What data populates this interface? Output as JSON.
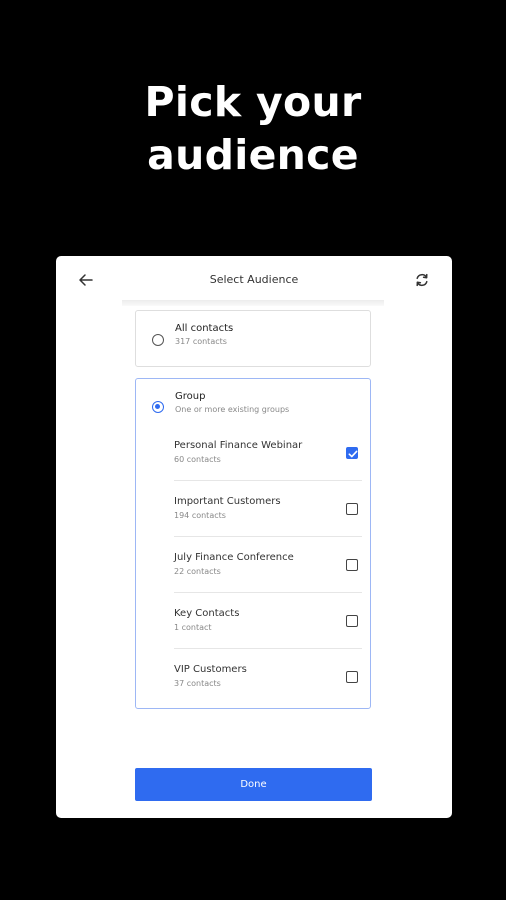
{
  "headline": {
    "line1": "Pick your",
    "line2": "audience"
  },
  "screen": {
    "title": "Select Audience"
  },
  "all_contacts": {
    "label": "All contacts",
    "count": "317 contacts",
    "selected": false
  },
  "group": {
    "label": "Group",
    "description": "One or more existing groups",
    "selected": true,
    "items": [
      {
        "label": "Personal Finance Webinar",
        "count": "60 contacts",
        "checked": true
      },
      {
        "label": "Important Customers",
        "count": "194 contacts",
        "checked": false
      },
      {
        "label": "July Finance Conference",
        "count": "22 contacts",
        "checked": false
      },
      {
        "label": "Key Contacts",
        "count": "1 contact",
        "checked": false
      },
      {
        "label": "VIP Customers",
        "count": "37 contacts",
        "checked": false
      }
    ]
  },
  "done_label": "Done",
  "colors": {
    "accent": "#2f6bf0",
    "background": "#000000",
    "card": "#ffffff"
  },
  "icons": {
    "back": "arrow-left-icon",
    "refresh": "refresh-icon"
  }
}
